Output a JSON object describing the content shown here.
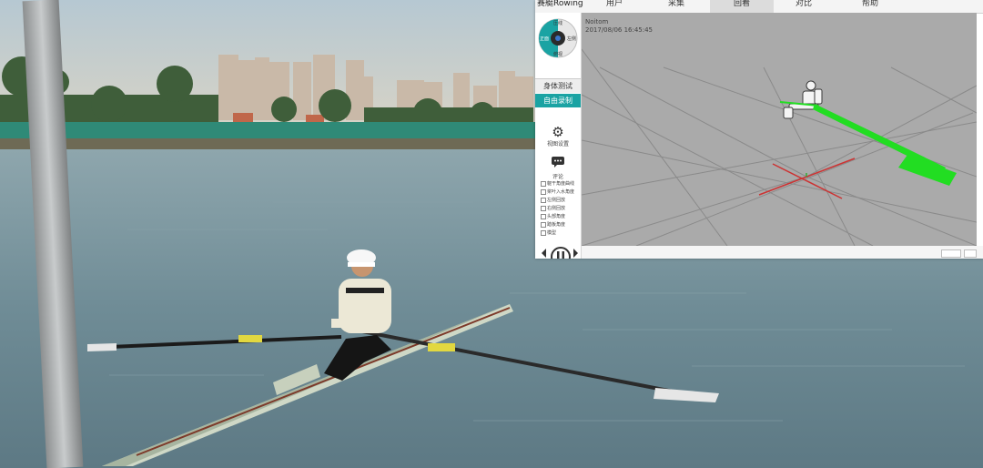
{
  "app": {
    "title": "赛艇Rowing",
    "tabs": [
      {
        "label": "用户",
        "active": false
      },
      {
        "label": "采集",
        "active": false
      },
      {
        "label": "回看",
        "active": true
      },
      {
        "label": "对比",
        "active": false
      },
      {
        "label": "帮助",
        "active": false
      }
    ]
  },
  "sidebar": {
    "dial": {
      "top": "压线",
      "left": "正面",
      "right": "左侧",
      "bottom": "俯视"
    },
    "buttons": {
      "body_test": "身体测试",
      "free_record": "自由录制"
    },
    "settings_label": "视图设置",
    "comment_label": "评论",
    "checkboxes": [
      "躯干角度曲线",
      "桨叶入水角度",
      "左侧回放",
      "右侧回放",
      "头部角度",
      "踏板角度",
      "模型"
    ]
  },
  "viewport": {
    "author": "Noitom",
    "timestamp": "2017/08/06 16:45:45",
    "background": "#aaaaaa",
    "oar_color": "#22dd22"
  },
  "colors": {
    "accent": "#1aa3a3",
    "sky_top": "#b6c8d2",
    "water": "#6f8c96"
  }
}
